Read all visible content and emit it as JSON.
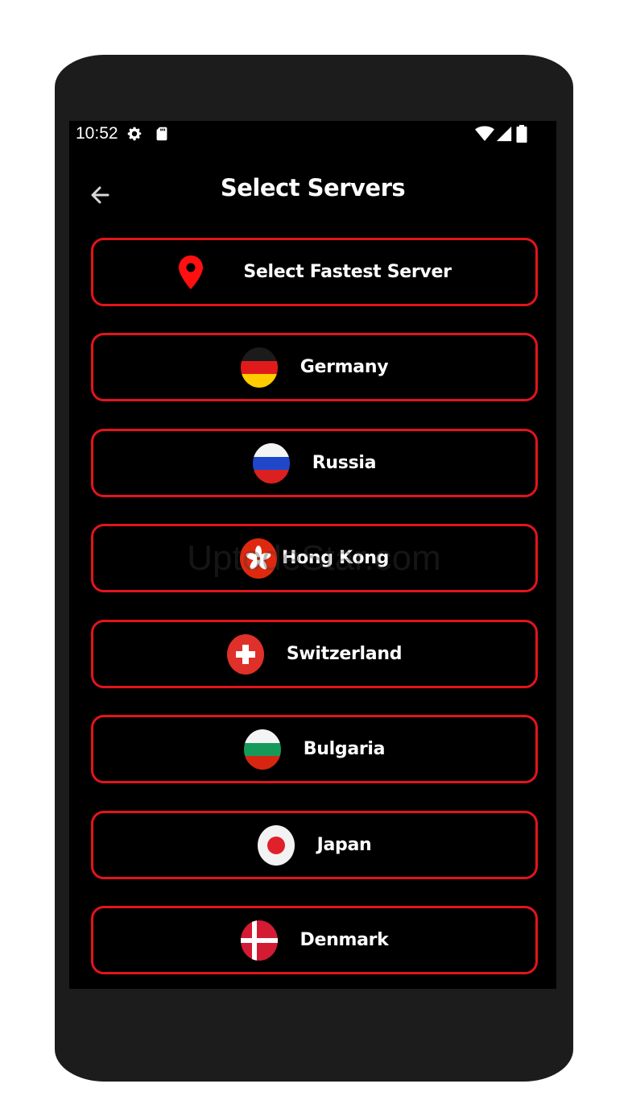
{
  "status_bar": {
    "time": "10:52",
    "icons": [
      "gear-icon",
      "sd-card-icon",
      "wifi-icon",
      "signal-icon",
      "battery-icon"
    ]
  },
  "header": {
    "title": "Select Servers",
    "back_icon": "arrow-left-icon"
  },
  "fastest": {
    "label": "Select Fastest Server",
    "icon": "location-pin-icon"
  },
  "servers": [
    {
      "label": "Germany",
      "flag": "germany-flag-icon"
    },
    {
      "label": "Russia",
      "flag": "russia-flag-icon"
    },
    {
      "label": "Hong Kong",
      "flag": "hong-kong-flag-icon"
    },
    {
      "label": "Switzerland",
      "flag": "switzerland-flag-icon"
    },
    {
      "label": "Bulgaria",
      "flag": "bulgaria-flag-icon"
    },
    {
      "label": "Japan",
      "flag": "japan-flag-icon"
    },
    {
      "label": "Denmark",
      "flag": "denmark-flag-icon"
    }
  ],
  "watermark": "UptodeStar.com",
  "colors": {
    "accent": "#e3141c",
    "screen_bg": "#000000",
    "phone_frame": "#1c1c1c",
    "text": "#ffffff"
  }
}
